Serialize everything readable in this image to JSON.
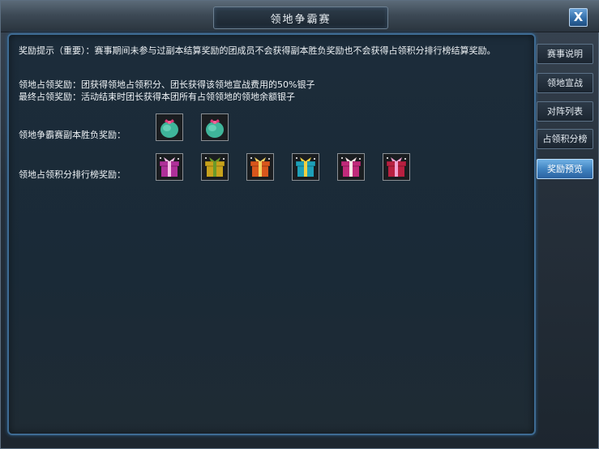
{
  "window": {
    "title": "领地争霸赛",
    "close_label": "X"
  },
  "notice": {
    "text": "奖励提示（重要）：赛事期间未参与过副本结算奖励的团成员不会获得副本胜负奖励也不会获得占领积分排行榜结算奖励。"
  },
  "rules": {
    "line1": "领地占领奖励：团获得领地占领积分、团长获得该领地宣战费用的50%银子",
    "line2": "最终占领奖励：活动结束时团长获得本团所有占领领地的领地余额银子"
  },
  "rewards": {
    "battle_label": "领地争霸赛副本胜负奖励：",
    "battle_icons": [
      "gift-pouch-icon",
      "gift-pouch-icon"
    ],
    "rank_label": "领地占领积分排行榜奖励：",
    "rank_icons": [
      {
        "name": "gift-box-magenta-icon",
        "box": "#b0309a",
        "ribbon": "#f5c0e6"
      },
      {
        "name": "gift-box-yellow-icon",
        "box": "#c8a21c",
        "ribbon": "#6a9a2a"
      },
      {
        "name": "gift-box-orange-icon",
        "box": "#d8561c",
        "ribbon": "#f2d060"
      },
      {
        "name": "gift-box-teal-icon",
        "box": "#1ea0b8",
        "ribbon": "#f0d040"
      },
      {
        "name": "gift-box-pink-red-icon",
        "box": "#c02a7a",
        "ribbon": "#f4e4e4"
      },
      {
        "name": "gift-box-crimson-icon",
        "box": "#b82040",
        "ribbon": "#f0a0d0"
      }
    ]
  },
  "sidebar": {
    "tabs": [
      {
        "label": "赛事说明",
        "active": false
      },
      {
        "label": "领地宣战",
        "active": false
      },
      {
        "label": "对阵列表",
        "active": false
      },
      {
        "label": "占领积分榜",
        "active": false
      },
      {
        "label": "奖励预览",
        "active": true
      }
    ]
  },
  "colors": {
    "accent_blue": "#3e80bd",
    "frame_border": "#3e6b93",
    "text": "#eef2f5"
  }
}
